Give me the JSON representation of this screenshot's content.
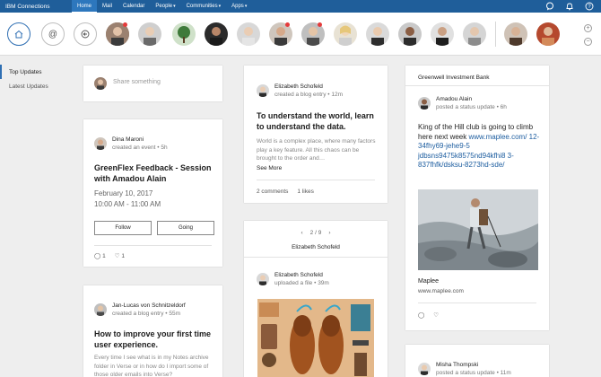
{
  "nav": {
    "brand": "IBM Connections",
    "items": [
      {
        "label": "Home",
        "active": true
      },
      {
        "label": "Mail",
        "active": false
      },
      {
        "label": "Calendar",
        "active": false
      },
      {
        "label": "People",
        "active": false,
        "has_menu": true
      },
      {
        "label": "Communities",
        "active": false,
        "has_menu": true
      },
      {
        "label": "Apps",
        "active": false,
        "has_menu": true
      }
    ],
    "icons": [
      "chat-icon",
      "bell-icon",
      "help-icon"
    ]
  },
  "filters": {
    "top": "Top Updates",
    "latest": "Latest Updates"
  },
  "share": {
    "placeholder": "Share something"
  },
  "card_dina": {
    "author": "Dina Maroni",
    "action": "created an event",
    "time": "5h",
    "title": "GreenFlex Feedback - Session with Amadou Alain",
    "date": "February 10, 2017",
    "time_range": "10:00 AM - 11:00 AM",
    "follow": "Follow",
    "going": "Going",
    "replies": "1",
    "likes": "1"
  },
  "card_jan": {
    "author": "Jan-Lucas von Schnitzeldorf",
    "action": "created a blog entry",
    "time": "55m",
    "title": "How to improve your first time user experience.",
    "body": "Every time I see what is in my Notes archive folder in Verse or in how do I import some of those older emails into Verse?"
  },
  "card_elizabeth_blog": {
    "author": "Elizabeth Schofeld",
    "action": "created a blog entry",
    "time": "12m",
    "title": "To understand the world, learn to understand the data.",
    "body": "World is a complex place, where many factors play a key feature. All this chaos can be brought to the order and…",
    "see_more": "See More",
    "comments": "2 comments",
    "likes": "1 likes"
  },
  "card_elizabeth_file": {
    "pager": "2 / 9",
    "header": "Elizabeth Schofeld",
    "author": "Elizabeth Schofeld",
    "action": "uploaded a file",
    "time": "39m"
  },
  "card_greenwell": {
    "header": "Greenwell Investment Bank",
    "author": "Amadou Alain",
    "action": "posted a status update",
    "time": "6h",
    "text": "King of the Hill club is going to climb here next week",
    "url": "www.maplee.com/ 12-34fhy69-jehe9-5 jdbsns9475k8575nd94kfhi8 3-837fhfk/dsksu-8273hd-sde/",
    "link_title": "Maplee",
    "link_domain": "www.maplee.com",
    "replies": "",
    "likes": ""
  },
  "card_misha": {
    "author": "Misha Thompski",
    "action": "posted a status update",
    "time": "11m"
  }
}
